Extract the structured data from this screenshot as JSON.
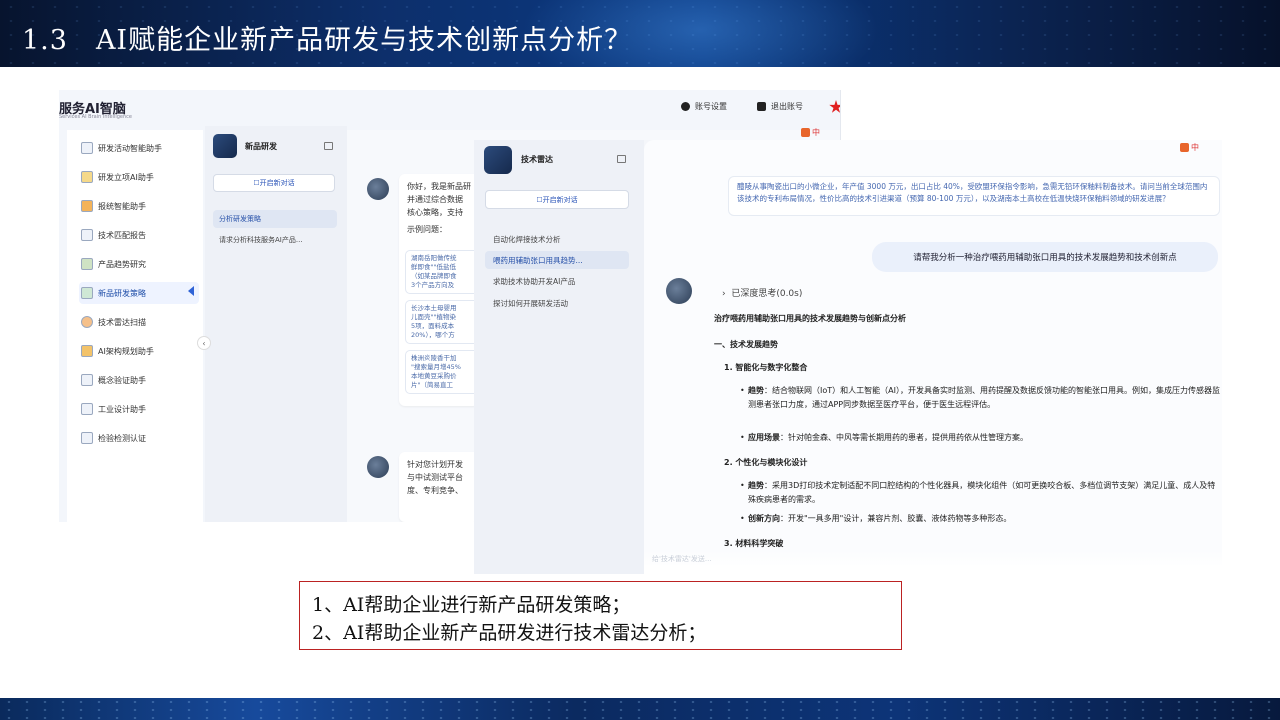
{
  "slide": {
    "title": "1.3　AI赋能企业新产品研发与技术创新点分析？",
    "caption_lines": [
      "1、AI帮助企业进行新产品研发策略；",
      "2、AI帮助企业新产品研发进行技术雷达分析；"
    ]
  },
  "screenshot1": {
    "brand": "服务AI智脑",
    "brand_sub": "Services AI Brain Intelligence",
    "header_links": [
      "账号设置",
      "退出账号"
    ],
    "sidebar": [
      "研发活动智能助手",
      "研发立项AI助手",
      "报统智能助手",
      "技术匹配报告",
      "产品趋势研究",
      "新品研发策略",
      "技术雷达扫描",
      "AI架构规划助手",
      "概念验证助手",
      "工业设计助手",
      "检验检测认证"
    ],
    "active_index": 5,
    "column": {
      "title": "新品研发",
      "new_chat": "开启新对话",
      "items": [
        "分析研发策略",
        "请求分析科技服务AI产品..."
      ]
    },
    "lang": "中",
    "chat": {
      "greeting_lines": [
        "你好，我是新品研",
        "并通过综合数据",
        "核心策略，支持"
      ],
      "examples_label": "示例问题：",
      "example_cards": [
        [
          "湖南岳阳做传统",
          "鲜即食\"\"低盐低",
          "（如某品牌即食",
          "3个产品方向及"
        ],
        [
          "长沙本土母婴用",
          "儿面壳\"\"植物染",
          "5项，面料成本",
          "20%），哪个方"
        ],
        [
          "株洲炎陵香干加",
          "\"搜索量月增45%",
          "本地黄豆采购价",
          "片\"（简易直工"
        ]
      ],
      "second_msg_lines": [
        "针对您计划开发",
        "与中试测试平台",
        "度、专利竞争、"
      ]
    }
  },
  "screenshot2": {
    "title": "技术雷达",
    "new_chat": "开启新对话",
    "items": [
      "自动化焊接技术分析",
      "喂药用辅助张口用具趋势...",
      "求助技术协助开发AI产品",
      "探讨如何开展研发活动"
    ],
    "active_index": 1,
    "lang": "中",
    "question_text": "醴陵从事陶瓷出口的小微企业，年产值 3000 万元，出口占比 40%，受欧盟环保指令影响，急需无铅环保釉料制备技术。请问当前全球范围内该技术的专利布局情况，性价比高的技术引进渠道（预算 80-100 万元），以及湖南本土高校在低温快烧环保釉料领域的研发进展？",
    "user_message": "请帮我分析一种治疗喂药用辅助张口用具的技术发展趋势和技术创新点",
    "thinking": "已深度思考(0.0s)",
    "answer": {
      "title": "治疗喂药用辅助张口用具的技术发展趋势与创新点分析",
      "section1": "一、技术发展趋势",
      "h1": "1. 智能化与数字化整合",
      "b1_label": "趋势",
      "b1_text": "：结合物联网（IoT）和人工智能（AI），开发具备实时监测、用药提醒及数据反馈功能的智能张口用具。例如，集成压力传感器监测患者张口力度，通过APP同步数据至医疗平台，便于医生远程评估。",
      "b2_label": "应用场景",
      "b2_text": "：针对帕金森、中风等需长期用药的患者，提供用药依从性管理方案。",
      "h2": "2. 个性化与模块化设计",
      "b3_label": "趋势",
      "b3_text": "：采用3D打印技术定制适配不同口腔结构的个性化器具，模块化组件（如可更换咬合板、多档位调节支架）满足儿童、成人及特殊疾病患者的需求。",
      "b4_label": "创新方向",
      "b4_text": "：开发\"一具多用\"设计，兼容片剂、胶囊、液体药物等多种形态。",
      "h3": "3. 材料科学突破",
      "input_hint": "给'技术雷达'发送..."
    }
  }
}
